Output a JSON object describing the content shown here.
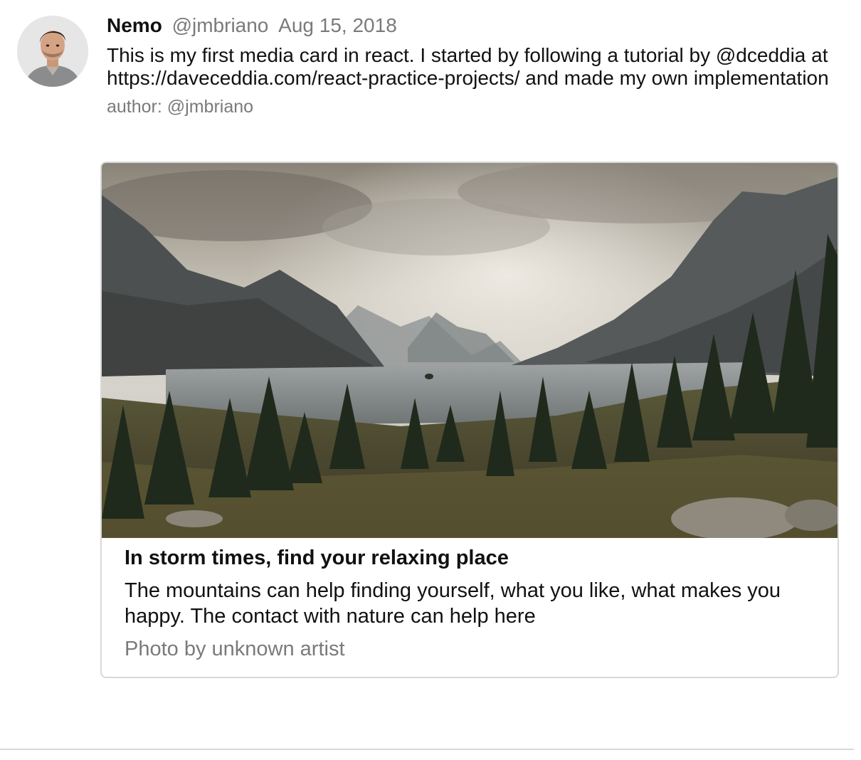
{
  "tweet": {
    "user_name": "Nemo",
    "user_handle": "@jmbriano",
    "date": "Aug 15, 2018",
    "message": "This is my first media card in react. I started by following a tutorial by @dceddia at https://daveceddia.com/react-practice-projects/ and made my own implementation",
    "author_line": "author: @jmbriano"
  },
  "card": {
    "title": "In storm times, find your relaxing place",
    "description": "The mountains can help finding yourself, what you like, what makes you happy. The contact with nature can help here",
    "credit": "Photo by unknown artist",
    "image_subject": "mountain-lake-landscape"
  },
  "colors": {
    "text": "#111111",
    "muted": "#7a7a7a",
    "border": "#d8d8d8",
    "background": "#ffffff"
  }
}
